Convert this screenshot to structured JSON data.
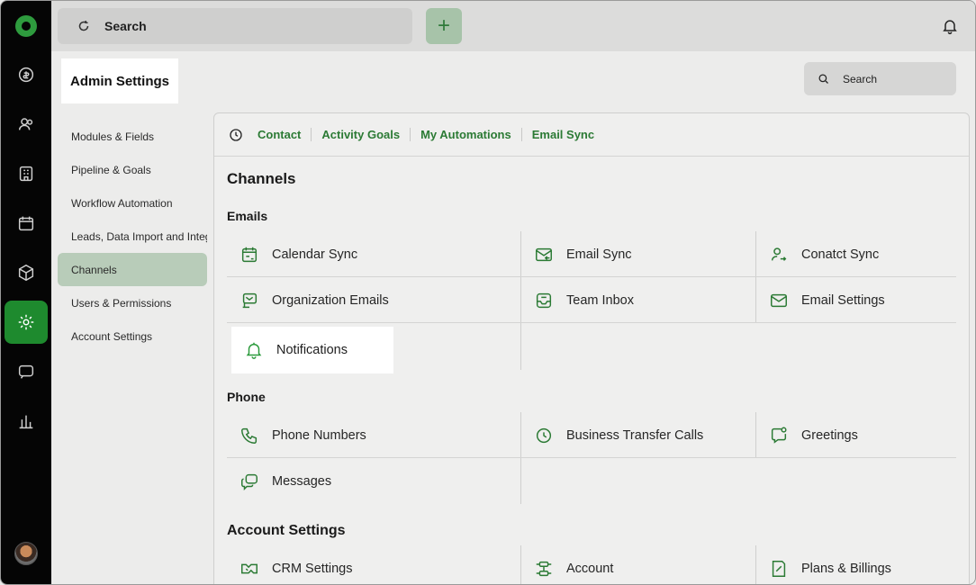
{
  "topbar": {
    "search_label": "Search",
    "add_label": "+"
  },
  "header": {
    "title": "Admin Settings",
    "search_label": "Search"
  },
  "nav": {
    "items": [
      {
        "label": "Modules & Fields"
      },
      {
        "label": "Pipeline & Goals"
      },
      {
        "label": "Workflow Automation"
      },
      {
        "label": "Leads, Data Import and Integrations"
      },
      {
        "label": "Channels",
        "active": true
      },
      {
        "label": "Users & Permissions"
      },
      {
        "label": "Account Settings"
      }
    ]
  },
  "quicklinks": [
    "Contact",
    "Activity Goals",
    "My Automations",
    "Email Sync"
  ],
  "page_title": "Channels",
  "sections": {
    "emails": {
      "title": "Emails",
      "items": [
        "Calendar Sync",
        "Email Sync",
        "Conatct Sync",
        "Organization Emails",
        "Team Inbox",
        "Email Settings",
        "Notifications"
      ]
    },
    "phone": {
      "title": "Phone",
      "items": [
        "Phone Numbers",
        "Business Transfer Calls",
        "Greetings",
        "Messages"
      ]
    },
    "account": {
      "title": "Account Settings",
      "items": [
        "CRM Settings",
        "Account",
        "Plans & Billings"
      ]
    }
  },
  "colors": {
    "accent": "#2b7a34",
    "rail": "#050505",
    "active_rail": "#1e8a2e",
    "nav_active": "#b8ccb9"
  }
}
